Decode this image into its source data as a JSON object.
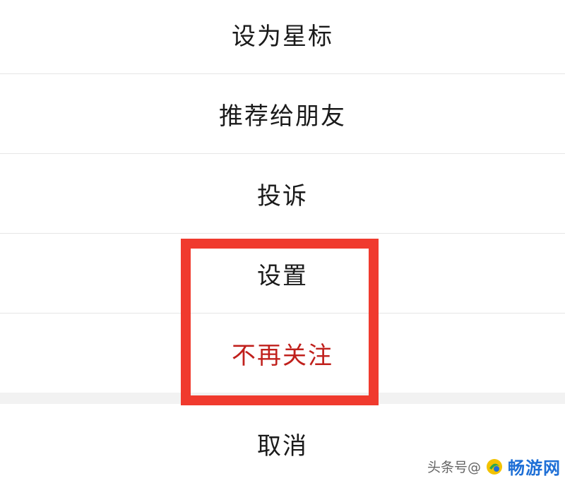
{
  "action_sheet": {
    "items": [
      {
        "label": "设为星标"
      },
      {
        "label": "推荐给朋友"
      },
      {
        "label": "投诉"
      },
      {
        "label": "设置"
      },
      {
        "label": "不再关注"
      }
    ],
    "cancel_label": "取消"
  },
  "highlight": {
    "color": "#f03a2e"
  },
  "watermark": {
    "text": "头条号@",
    "site": "畅游网",
    "site_color": "#1e6fd6"
  }
}
